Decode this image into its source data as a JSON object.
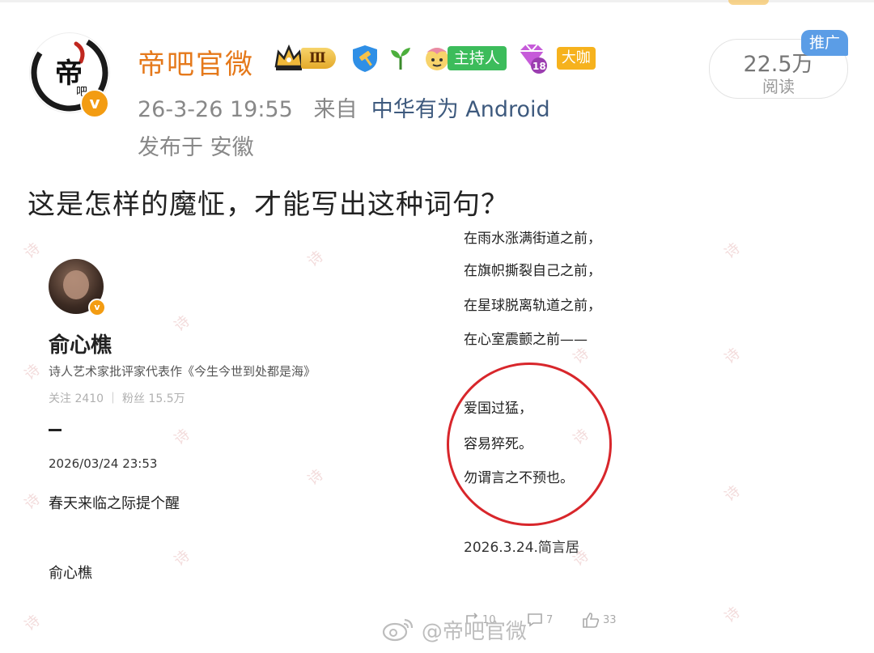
{
  "post": {
    "author": {
      "name": "帝吧官微",
      "avatar_char": "帝",
      "avatar_char2": "吧",
      "verified_mark": "v",
      "badges": {
        "level": "Ⅲ",
        "host": "主持人",
        "vip_level": "18",
        "dakai": "大咖"
      }
    },
    "time": "26-3-26 19:55",
    "source_prefix": "来自",
    "source": "中华有为 Android",
    "location": "发布于 安徽",
    "reads": "22.5万",
    "reads_label": "阅读",
    "ad_tag": "推广",
    "text": "这是怎样的魔怔，才能写出这种词句？"
  },
  "embedded": {
    "profile": {
      "name": "俞心樵",
      "desc": "诗人艺术家批评家代表作《今生今世到处都是海》",
      "stats": "关注 2410 ｜ 粉丝 15.5万",
      "verified_mark": "v"
    },
    "dash": "-",
    "date": "2026/03/24 23:53",
    "remind": "春天来临之际提个醒",
    "sign": "俞心樵",
    "poem_lines": [
      "在雨水涨满街道之前，",
      "在旗帜撕裂自己之前，",
      "在星球脱离轨道之前，",
      "在心室震颤之前——"
    ],
    "circled_lines": [
      "爱国过猛，",
      "容易猝死。",
      "勿谓言之不预也。"
    ],
    "poem_signature": "2026.3.24.简言居",
    "actions": {
      "repost": "10",
      "comment": "7",
      "like": "33"
    },
    "watermark_text": "@帝吧官微",
    "watermark_bg": "诗"
  },
  "colors": {
    "username": "#e5791b",
    "source_link": "#3e5a7e",
    "circle": "#d8262b",
    "ad_tag": "#5b9de6",
    "host_badge": "#3cbc5b"
  }
}
